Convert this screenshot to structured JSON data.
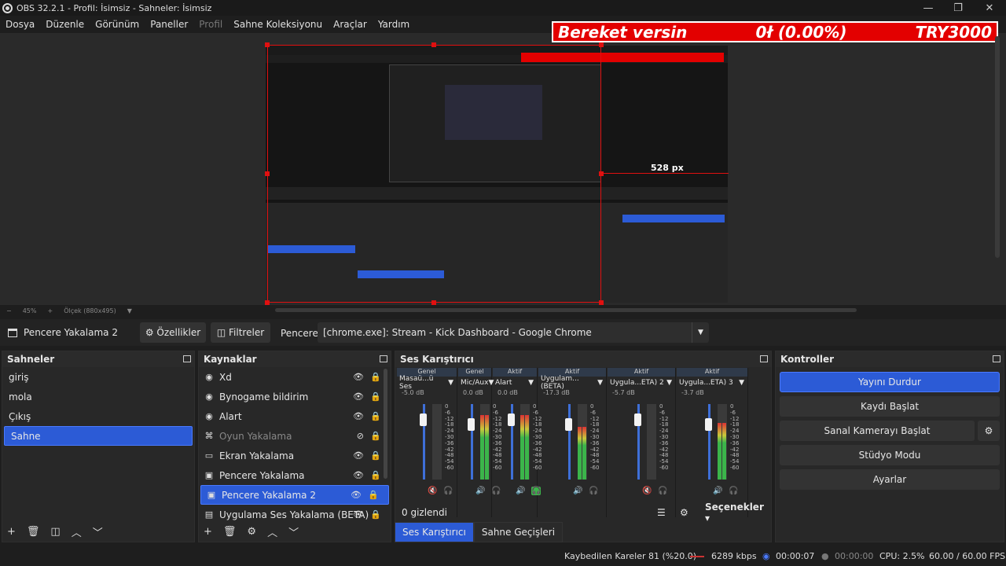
{
  "window": {
    "title": "OBS 32.2.1 - Profil: İsimsiz - Sahneler: İsimsiz",
    "min": "—",
    "max": "❐",
    "close": "✕"
  },
  "menu": [
    "Dosya",
    "Düzenle",
    "Görünüm",
    "Paneller",
    "Profil",
    "Sahne Koleksiyonu",
    "Araçlar",
    "Yardım"
  ],
  "banner": {
    "left": "Bereket versin",
    "middle": "0ł (0.00%)",
    "right": "TRY3000"
  },
  "preview": {
    "px_label": "528 px",
    "zoom": "45%",
    "scale": "Ölçek (880x495)"
  },
  "source_toolbar": {
    "source": "Pencere Yakalama 2",
    "properties": "Özellikler",
    "filters": "Filtreler",
    "window_label": "Pencere",
    "window_value": "[chrome.exe]: Stream - Kick Dashboard - Google Chrome"
  },
  "scenes": {
    "title": "Sahneler",
    "items": [
      "giriş",
      "mola",
      "Çıkış",
      "Sahne"
    ]
  },
  "sources": {
    "title": "Kaynaklar",
    "items": [
      "Xd",
      "Bynogame bildirim",
      "Alart",
      "Oyun Yakalama",
      "Ekran Yakalama",
      "Pencere Yakalama",
      "Pencere Yakalama 2",
      "Uygulama Ses Yakalama (BETA)"
    ]
  },
  "mixer": {
    "title": "Ses Karıştırıcı",
    "channels": [
      {
        "tag": "Genel",
        "name": "Masaü...ü Ses",
        "db": "-5.0 dB",
        "level": 0.0
      },
      {
        "tag": "Genel",
        "name": "Mic/Aux",
        "db": "0.0 dB",
        "level": 0.85
      },
      {
        "tag": "Aktif",
        "name": "Alart",
        "db": "0.0 dB",
        "level": 0.85
      },
      {
        "tag": "Aktif",
        "name": "Uygulam... (BETA)",
        "db": "-17.3 dB",
        "level": 0.7
      },
      {
        "tag": "Aktif",
        "name": "Uygula...ETA) 2",
        "db": "-5.7 dB",
        "level": 0.0
      },
      {
        "tag": "Aktif",
        "name": "Uygula...ETA) 3",
        "db": "-3.7 dB",
        "level": 0.75
      }
    ],
    "scale_labels": [
      "0",
      "-6",
      "-12",
      "-18",
      "-24",
      "-30",
      "-36",
      "-42",
      "-48",
      "-54",
      "-60"
    ],
    "hidden": "0 gizlendi",
    "options": "Seçenekler"
  },
  "tabs": [
    "Ses Karıştırıcı",
    "Sahne Geçişleri"
  ],
  "controls": {
    "title": "Kontroller",
    "buttons": [
      "Yayını Durdur",
      "Kaydı Başlat",
      "Sanal Kamerayı Başlat",
      "Stüdyo Modu",
      "Ayarlar"
    ]
  },
  "status": {
    "dropped": "Kaybedilen Kareler 81 (%20.0)",
    "bitrate": "6289 kbps",
    "stream_time": "00:00:07",
    "rec_time": "00:00:00",
    "cpu": "CPU: 2.5%",
    "fps": "60.00 / 60.00 FPS"
  },
  "colors": {
    "accent": "#2c5bd6",
    "banner": "#e30000",
    "selection_red": "#e01010"
  }
}
